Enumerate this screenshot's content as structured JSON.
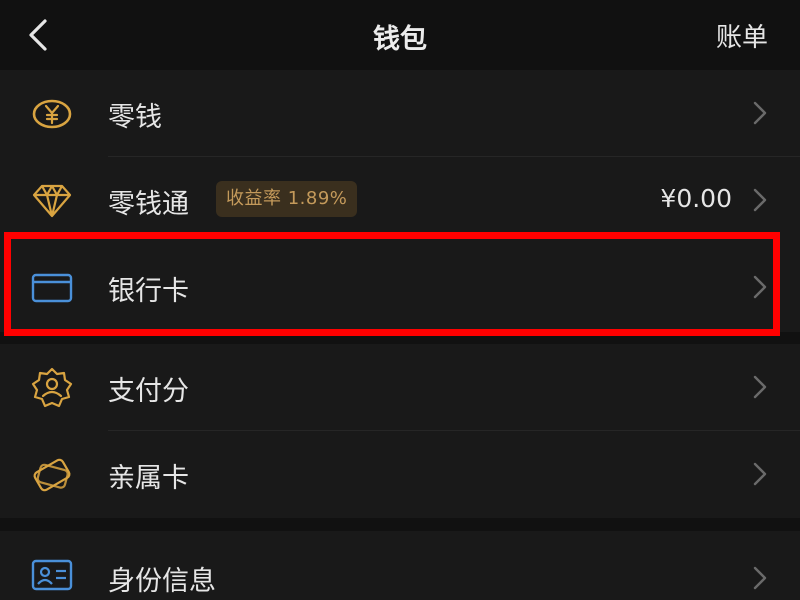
{
  "header": {
    "title": "钱包",
    "bill_label": "账单"
  },
  "wallet": {
    "items": [
      {
        "label": "零钱",
        "icon": "yuan-coin-icon"
      },
      {
        "label": "零钱通",
        "icon": "diamond-icon",
        "badge": "收益率 1.89%",
        "value": "¥0.00"
      },
      {
        "label": "银行卡",
        "icon": "bank-card-icon"
      }
    ]
  },
  "services": {
    "items": [
      {
        "label": "支付分",
        "icon": "pay-score-badge-icon"
      },
      {
        "label": "亲属卡",
        "icon": "family-card-icon"
      }
    ]
  },
  "identity": {
    "items": [
      {
        "label": "身份信息",
        "icon": "id-card-icon"
      }
    ]
  },
  "colors": {
    "background": "#111111",
    "row": "#191919",
    "gold_icon": "#d9a441",
    "blue_icon": "#4a90d9",
    "badge_bg": "#3a2f1e",
    "badge_text": "#c49a5b",
    "highlight": "#ff0000"
  }
}
